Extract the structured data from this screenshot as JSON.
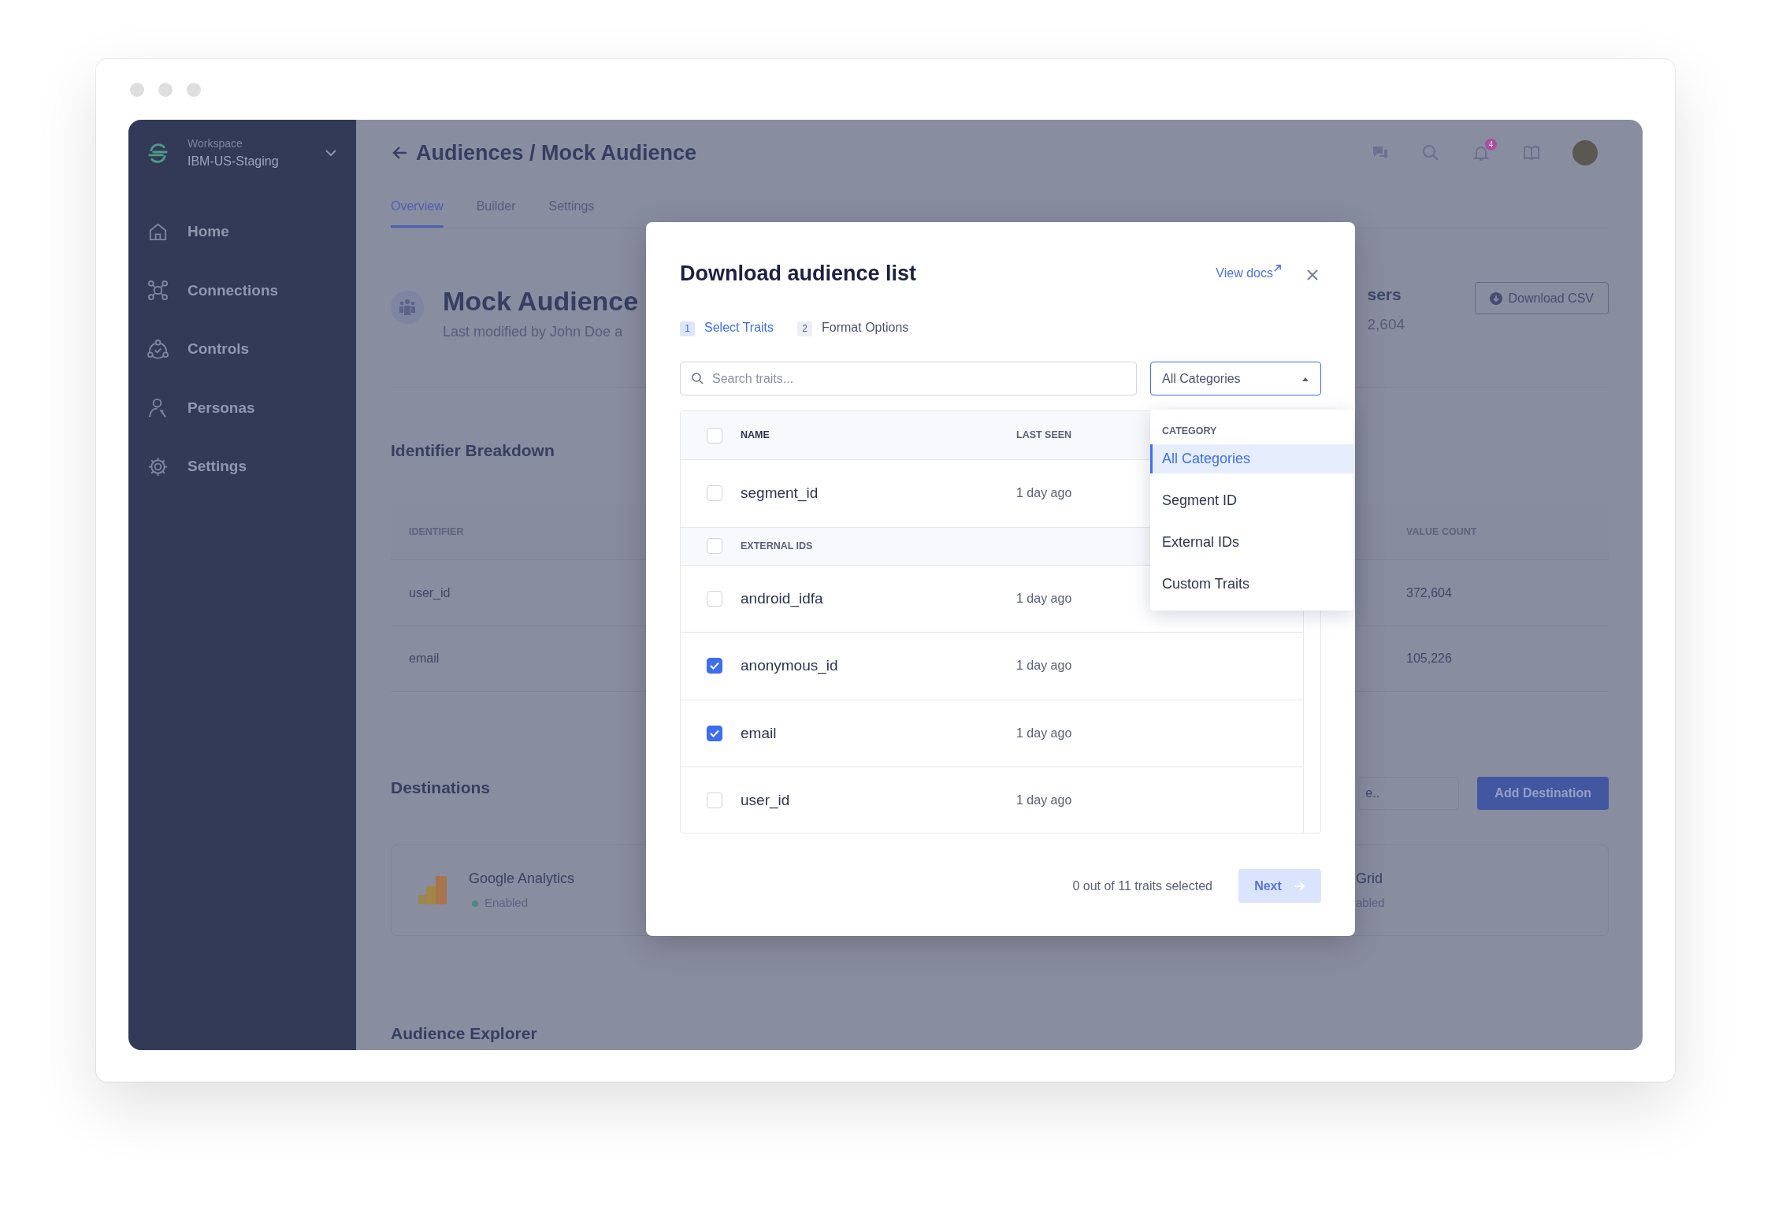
{
  "sidebar": {
    "workspace_label": "Workspace",
    "workspace_name": "IBM-US-Staging",
    "items": [
      {
        "label": "Home"
      },
      {
        "label": "Connections"
      },
      {
        "label": "Controls"
      },
      {
        "label": "Personas"
      },
      {
        "label": "Settings"
      }
    ]
  },
  "header": {
    "title": "Audiences / Mock Audience",
    "notification_count": "4",
    "tabs": [
      {
        "label": "Overview",
        "selected": true
      },
      {
        "label": "Builder",
        "selected": false
      },
      {
        "label": "Settings",
        "selected": false
      }
    ]
  },
  "audience": {
    "title": "Mock Audience",
    "subtitle": "Last modified by John Doe a",
    "stat_label": "sers",
    "stat_value": "2,604",
    "download_button": "Download CSV"
  },
  "identifier_breakdown": {
    "title": "Identifier Breakdown",
    "columns": [
      "IDENTIFIER",
      "VALUE COUNT"
    ],
    "rows": [
      [
        "user_id",
        "372,604"
      ],
      [
        "email",
        "105,226"
      ]
    ]
  },
  "destinations": {
    "title": "Destinations",
    "search": {
      "placeholder": "e.."
    },
    "add_button": "Add Destination",
    "cards": [
      {
        "name": "Google Analytics",
        "status": "Enabled",
        "status_dot": true,
        "logo": true
      },
      {
        "name": "Grid",
        "status": "abled",
        "status_dot": false,
        "logo": false
      }
    ]
  },
  "explorer": {
    "title": "Audience Explorer"
  },
  "modal": {
    "title": "Download audience list",
    "docs_link": "View docs",
    "steps": [
      {
        "number": "1",
        "label": "Select Traits",
        "selected": true
      },
      {
        "number": "2",
        "label": "Format Options",
        "selected": false
      }
    ],
    "search": {
      "placeholder": "Search traits..."
    },
    "category_select": {
      "value": "All Categories",
      "expanded": true
    },
    "table": {
      "columns": [
        "NAME",
        "LAST SEEN"
      ],
      "select_all_checked": false,
      "rows": [
        {
          "kind": "trait",
          "name": "segment_id",
          "last_seen": "1 day ago",
          "checked": false
        },
        {
          "kind": "group",
          "name": "EXTERNAL IDS",
          "checked": false
        },
        {
          "kind": "trait",
          "name": "android_idfa",
          "last_seen": "1 day ago",
          "checked": false
        },
        {
          "kind": "trait",
          "name": "anonymous_id",
          "last_seen": "1 day ago",
          "checked": true
        },
        {
          "kind": "trait",
          "name": "email",
          "last_seen": "1 day ago",
          "checked": true
        },
        {
          "kind": "trait",
          "name": "user_id",
          "last_seen": "1 day ago",
          "checked": false
        }
      ]
    },
    "dropdown": {
      "heading": "CATEGORY",
      "options": [
        {
          "label": "All Categories",
          "selected": true
        },
        {
          "label": "Segment ID",
          "selected": false
        },
        {
          "label": "External IDs",
          "selected": false
        },
        {
          "label": "Custom Traits",
          "selected": false
        }
      ]
    },
    "footer": {
      "count_text": "0 out of 11 traits selected",
      "next_button": "Next",
      "next_disabled": true
    }
  }
}
